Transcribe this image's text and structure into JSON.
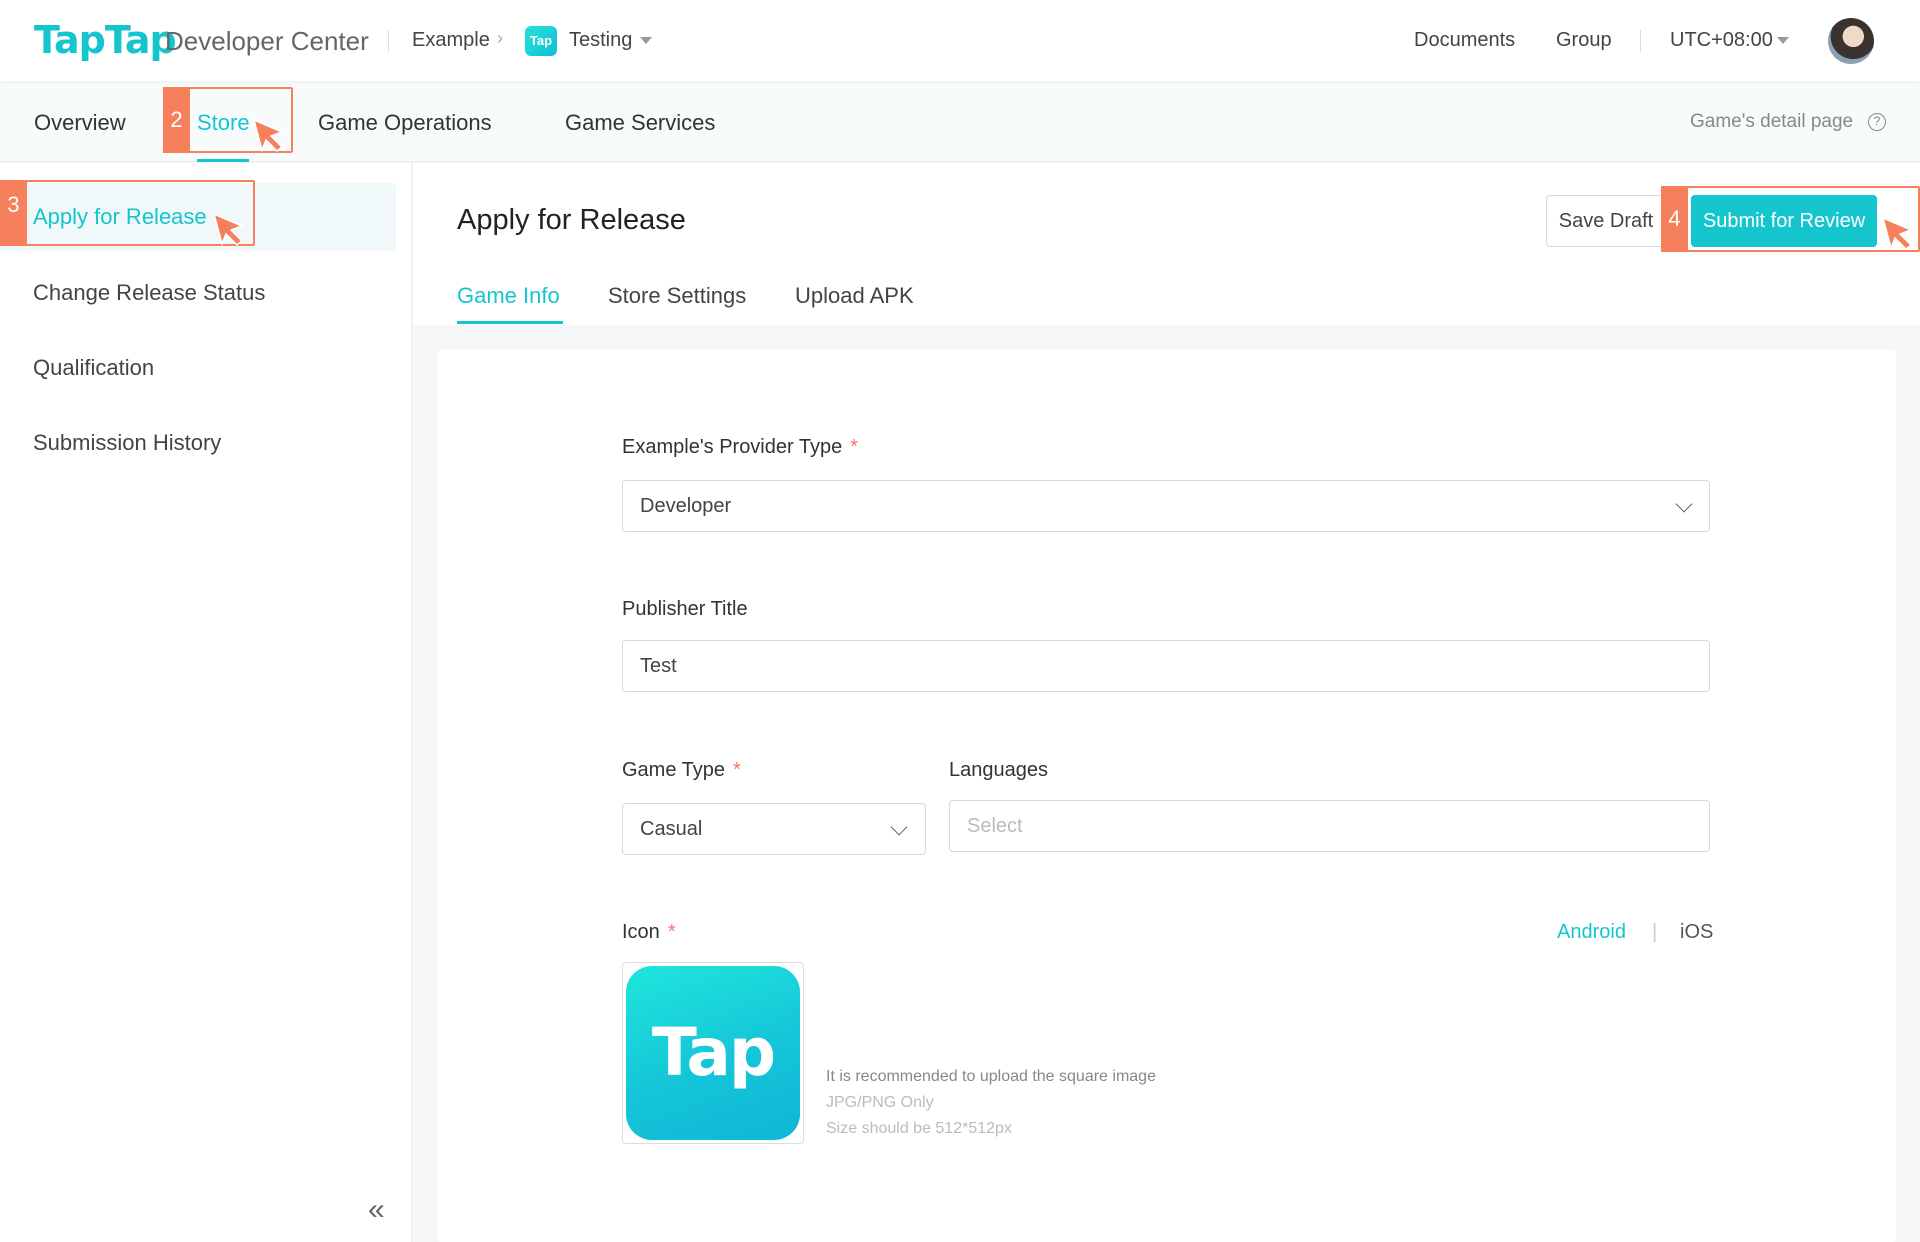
{
  "header": {
    "logo": "TapTap",
    "logo_sub": "Developer Center",
    "breadcrumb": {
      "org": "Example",
      "app_badge": "Tap",
      "app": "Testing"
    },
    "nav": {
      "documents": "Documents",
      "group": "Group",
      "timezone": "UTC+08:00"
    }
  },
  "subnav": {
    "items": [
      "Overview",
      "Store",
      "Game Operations",
      "Game Services"
    ],
    "active": "Store",
    "detail_link": "Game's detail page",
    "detail_icon": "?"
  },
  "sidebar": {
    "items": [
      "Apply for Release",
      "Change Release Status",
      "Qualification",
      "Submission History"
    ],
    "active": "Apply for Release",
    "collapse_glyph": "«"
  },
  "main": {
    "title": "Apply for Release",
    "save_draft": "Save Draft",
    "submit": "Submit for Review",
    "tabs": [
      "Game Info",
      "Store Settings",
      "Upload APK"
    ],
    "active_tab": "Game Info"
  },
  "form": {
    "provider_type": {
      "label": "Example's Provider Type",
      "required": "*",
      "value": "Developer"
    },
    "publisher_title": {
      "label": "Publisher Title",
      "value": "Test"
    },
    "game_type": {
      "label": "Game Type",
      "required": "*",
      "value": "Casual"
    },
    "languages": {
      "label": "Languages",
      "placeholder": "Select"
    },
    "icon": {
      "label": "Icon",
      "required": "*",
      "platforms": [
        "Android",
        "iOS"
      ],
      "platform_separator": "|",
      "active_platform": "Android",
      "image_text": "Tap",
      "hints": [
        "It is recommended to upload the square image",
        "JPG/PNG Only",
        "Size should be 512*512px"
      ]
    }
  },
  "annotations": {
    "step2": "2",
    "step3": "3",
    "step4": "4"
  },
  "colors": {
    "accent": "#15c5ce",
    "annotation": "#f5805b",
    "required": "#f5756b"
  }
}
